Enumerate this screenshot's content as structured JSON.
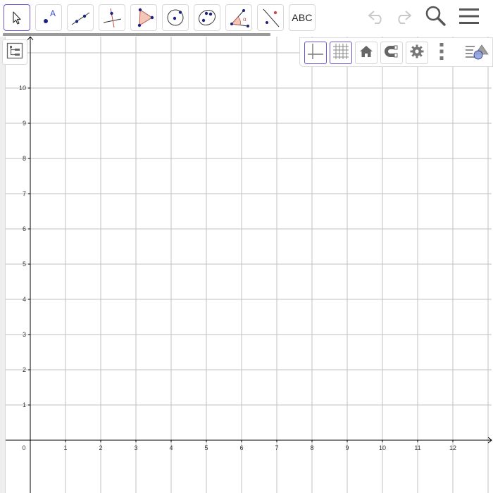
{
  "toolbar": {
    "tools": [
      {
        "name": "move-tool-button",
        "icon": "arrow-pointer-icon",
        "selected": true
      },
      {
        "name": "point-tool-button",
        "icon": "point-icon",
        "label": "A"
      },
      {
        "name": "line-tool-button",
        "icon": "line-icon"
      },
      {
        "name": "perpendicular-line-tool-button",
        "icon": "perpendicular-line-icon"
      },
      {
        "name": "polygon-tool-button",
        "icon": "polygon-icon"
      },
      {
        "name": "circle-tool-button",
        "icon": "circle-center-icon"
      },
      {
        "name": "ellipse-tool-button",
        "icon": "ellipse-icon"
      },
      {
        "name": "angle-tool-button",
        "icon": "angle-icon",
        "label": "α"
      },
      {
        "name": "reflect-tool-button",
        "icon": "reflect-icon"
      },
      {
        "name": "text-tool-button",
        "icon": "text-icon",
        "label": "ABC"
      }
    ],
    "right_icons": [
      "undo-icon",
      "redo-icon",
      "search-icon",
      "menu-icon"
    ]
  },
  "style_bar": {
    "buttons": [
      "axes-icon",
      "grid-icon",
      "home-icon",
      "magnet-icon",
      "gear-icon",
      "more-vertical-icon",
      "style-bar-toggle-icon"
    ]
  },
  "graph": {
    "x_tick_labels": [
      "0",
      "1",
      "2",
      "3",
      "4",
      "5",
      "6",
      "7",
      "8",
      "9",
      "10",
      "11",
      "12"
    ],
    "y_tick_labels": [
      "1",
      "2",
      "3",
      "4",
      "5",
      "6",
      "7",
      "8",
      "9",
      "10"
    ]
  },
  "colors": {
    "accent": "#6557d2",
    "point": "#1a237e",
    "polygon_fill": "#f1c8b8",
    "polygon_stroke": "#c0504d",
    "grid": "#c0c0c0",
    "axis": "#000000"
  }
}
